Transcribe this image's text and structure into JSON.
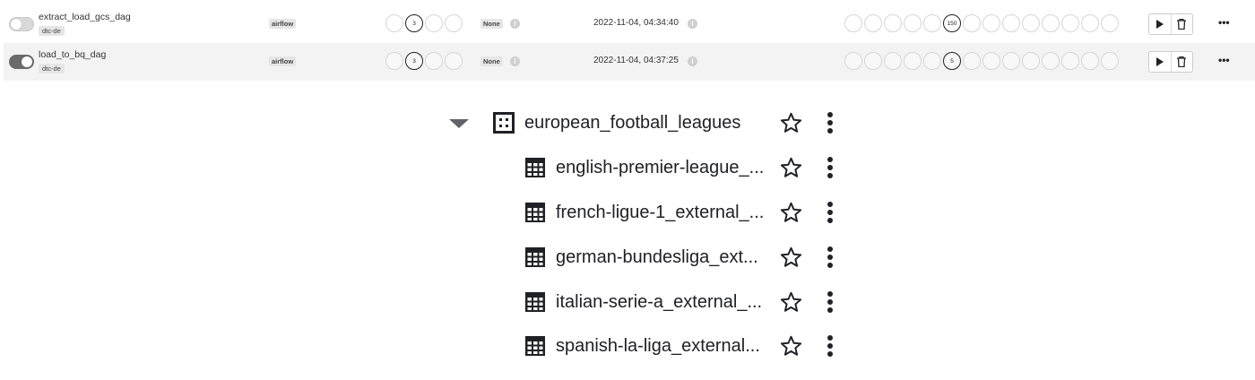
{
  "dags": [
    {
      "name": "extract_load_gcs_dag",
      "tag": "dtc-de",
      "owner": "airflow",
      "toggle_on": false,
      "runs": [
        "",
        "3",
        "",
        ""
      ],
      "schedule": "None",
      "last_run": "2022-11-04, 04:34:40",
      "recent_tasks": [
        "",
        "",
        "",
        "",
        "",
        "150",
        "",
        "",
        "",
        "",
        "",
        "",
        "",
        "",
        ""
      ],
      "more": "•••"
    },
    {
      "name": "load_to_bq_dag",
      "tag": "dtc-de",
      "owner": "airflow",
      "toggle_on": true,
      "runs": [
        "",
        "3",
        "",
        ""
      ],
      "schedule": "None",
      "last_run": "2022-11-04, 04:37:25",
      "recent_tasks": [
        "",
        "",
        "",
        "",
        "",
        "5",
        "",
        "",
        "",
        "",
        "",
        "",
        "",
        "",
        ""
      ],
      "more": "•••"
    }
  ],
  "explorer": {
    "dataset": {
      "name": "european_football_leagues",
      "icon": "dataset-icon"
    },
    "tables": [
      {
        "name": "english-premier-league_...",
        "icon": "table-icon"
      },
      {
        "name": "french-ligue-1_external_...",
        "icon": "table-icon"
      },
      {
        "name": "german-bundesliga_ext...",
        "icon": "table-icon"
      },
      {
        "name": "italian-serie-a_external_...",
        "icon": "table-icon"
      },
      {
        "name": "spanish-la-liga_external...",
        "icon": "table-icon"
      }
    ]
  }
}
